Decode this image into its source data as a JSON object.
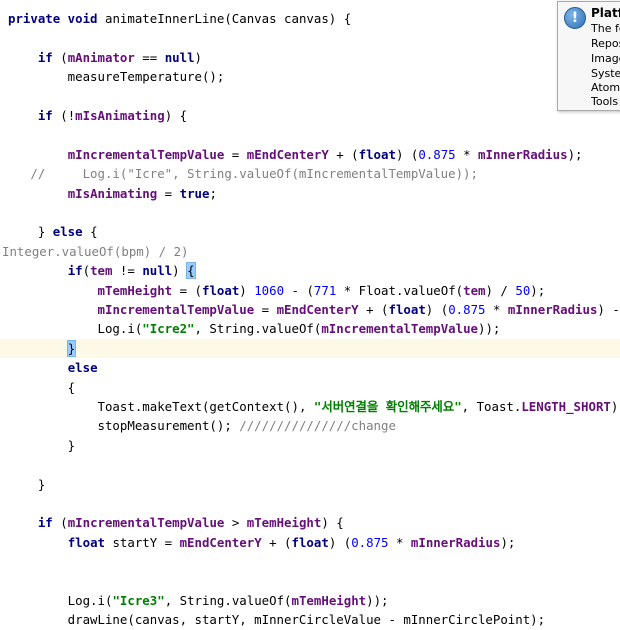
{
  "editor": {
    "lines": [
      [
        [
          "kw",
          "private void "
        ],
        [
          "t",
          "animateInnerLine(Canvas canvas) {"
        ]
      ],
      [],
      [
        [
          "t",
          "    "
        ],
        [
          "kw",
          "if "
        ],
        [
          "t",
          "("
        ],
        [
          "fld",
          "mAnimator"
        ],
        [
          "t",
          " == "
        ],
        [
          "kw",
          "null"
        ],
        [
          "t",
          ")"
        ]
      ],
      [
        [
          "t",
          "        measureTemperature();"
        ]
      ],
      [],
      [
        [
          "t",
          "    "
        ],
        [
          "kw",
          "if "
        ],
        [
          "t",
          "(!"
        ],
        [
          "fld",
          "mIsAnimating"
        ],
        [
          "t",
          ") {"
        ]
      ],
      [],
      [
        [
          "t",
          "        "
        ],
        [
          "fld",
          "mIncrementalTempValue"
        ],
        [
          "t",
          " = "
        ],
        [
          "fld",
          "mEndCenterY"
        ],
        [
          "t",
          " + ("
        ],
        [
          "kw",
          "float"
        ],
        [
          "t",
          ") ("
        ],
        [
          "num",
          "0.875"
        ],
        [
          "t",
          " * "
        ],
        [
          "fld",
          "mInnerRadius"
        ],
        [
          "t",
          ");"
        ]
      ],
      [
        [
          "cmt",
          "   //     Log.i(\"Icre\", String.valueOf(mIncrementalTempValue));"
        ]
      ],
      [
        [
          "t",
          "        "
        ],
        [
          "fld",
          "mIsAnimating"
        ],
        [
          "t",
          " = "
        ],
        [
          "kw",
          "true"
        ],
        [
          "t",
          ";"
        ]
      ],
      [],
      [
        [
          "t",
          "    } "
        ],
        [
          "kw",
          "else"
        ],
        [
          "t",
          " {"
        ]
      ],
      [
        [
          "hint",
          "Integer.valueOf(bpm) / 2)"
        ]
      ],
      [
        [
          "t",
          "        "
        ],
        [
          "kw",
          "if"
        ],
        [
          "t",
          "("
        ],
        [
          "fld",
          "tem"
        ],
        [
          "t",
          " != "
        ],
        [
          "kw",
          "null"
        ],
        [
          "t",
          ") "
        ],
        [
          "brace",
          "{"
        ]
      ],
      [
        [
          "t",
          "            "
        ],
        [
          "fld",
          "mTemHeight"
        ],
        [
          "t",
          " = ("
        ],
        [
          "kw",
          "float"
        ],
        [
          "t",
          ") "
        ],
        [
          "num",
          "1060"
        ],
        [
          "t",
          " - ("
        ],
        [
          "num",
          "771"
        ],
        [
          "t",
          " * Float."
        ],
        [
          "t",
          "valueOf"
        ],
        [
          "t",
          "("
        ],
        [
          "fld",
          "tem"
        ],
        [
          "t",
          ") / "
        ],
        [
          "num",
          "50"
        ],
        [
          "t",
          ");"
        ]
      ],
      [
        [
          "t",
          "            "
        ],
        [
          "fld",
          "mIncrementalTempValue"
        ],
        [
          "t",
          " = "
        ],
        [
          "fld",
          "mEndCenterY"
        ],
        [
          "t",
          " + ("
        ],
        [
          "kw",
          "float"
        ],
        [
          "t",
          ") ("
        ],
        [
          "num",
          "0.875"
        ],
        [
          "t",
          " * "
        ],
        [
          "fld",
          "mInnerRadius"
        ],
        [
          "t",
          ") - "
        ],
        [
          "fld",
          "mIncrementalTempValue"
        ]
      ],
      [
        [
          "t",
          "            Log."
        ],
        [
          "t",
          "i"
        ],
        [
          "t",
          "("
        ],
        [
          "str",
          "\"Icre2\""
        ],
        [
          "t",
          ", String."
        ],
        [
          "t",
          "valueOf"
        ],
        [
          "t",
          "("
        ],
        [
          "fld",
          "mIncrementalTempValue"
        ],
        [
          "t",
          "));"
        ]
      ],
      [
        [
          "t",
          "        "
        ],
        [
          "brace",
          "}"
        ],
        [
          "caret",
          ""
        ]
      ],
      [
        [
          "t",
          "        "
        ],
        [
          "kw",
          "else"
        ]
      ],
      [
        [
          "t",
          "        {"
        ]
      ],
      [
        [
          "t",
          "            Toast."
        ],
        [
          "t",
          "makeText"
        ],
        [
          "t",
          "(getContext(), "
        ],
        [
          "str",
          "\"서버연결을 확인해주세요\""
        ],
        [
          "t",
          ", Toast."
        ],
        [
          "fld",
          "LENGTH_SHORT"
        ],
        [
          "t",
          ").show();"
        ]
      ],
      [
        [
          "t",
          "            stopMeasurement(); "
        ],
        [
          "cmt",
          "///////////////change"
        ]
      ],
      [
        [
          "t",
          "        }"
        ]
      ],
      [],
      [
        [
          "t",
          "    }"
        ]
      ],
      [],
      [
        [
          "t",
          "    "
        ],
        [
          "kw",
          "if "
        ],
        [
          "t",
          "("
        ],
        [
          "fld",
          "mIncrementalTempValue"
        ],
        [
          "t",
          " > "
        ],
        [
          "fld",
          "mTemHeight"
        ],
        [
          "t",
          ") {"
        ]
      ],
      [
        [
          "t",
          "        "
        ],
        [
          "kw",
          "float "
        ],
        [
          "t",
          "startY = "
        ],
        [
          "fld",
          "mEndCenterY"
        ],
        [
          "t",
          " + ("
        ],
        [
          "kw",
          "float"
        ],
        [
          "t",
          ") ("
        ],
        [
          "num",
          "0.875"
        ],
        [
          "t",
          " * "
        ],
        [
          "fld",
          "mInnerRadius"
        ],
        [
          "t",
          ");"
        ]
      ],
      [],
      [],
      [
        [
          "t",
          "        Log."
        ],
        [
          "t",
          "i"
        ],
        [
          "t",
          "("
        ],
        [
          "str",
          "\"Icre3\""
        ],
        [
          "t",
          ", String."
        ],
        [
          "t",
          "valueOf"
        ],
        [
          "t",
          "("
        ],
        [
          "fld",
          "mTemHeight"
        ],
        [
          "t",
          "));"
        ]
      ],
      [
        [
          "t",
          "        drawLine(canvas, startY, mInnerCircleValue - mInnerCirclePoint);"
        ]
      ]
    ],
    "current_line": 17
  },
  "popup": {
    "title": "Platfo",
    "entries": [
      "The fo",
      "Repos",
      "Image",
      "Syster",
      "Atom",
      "Tools"
    ]
  }
}
